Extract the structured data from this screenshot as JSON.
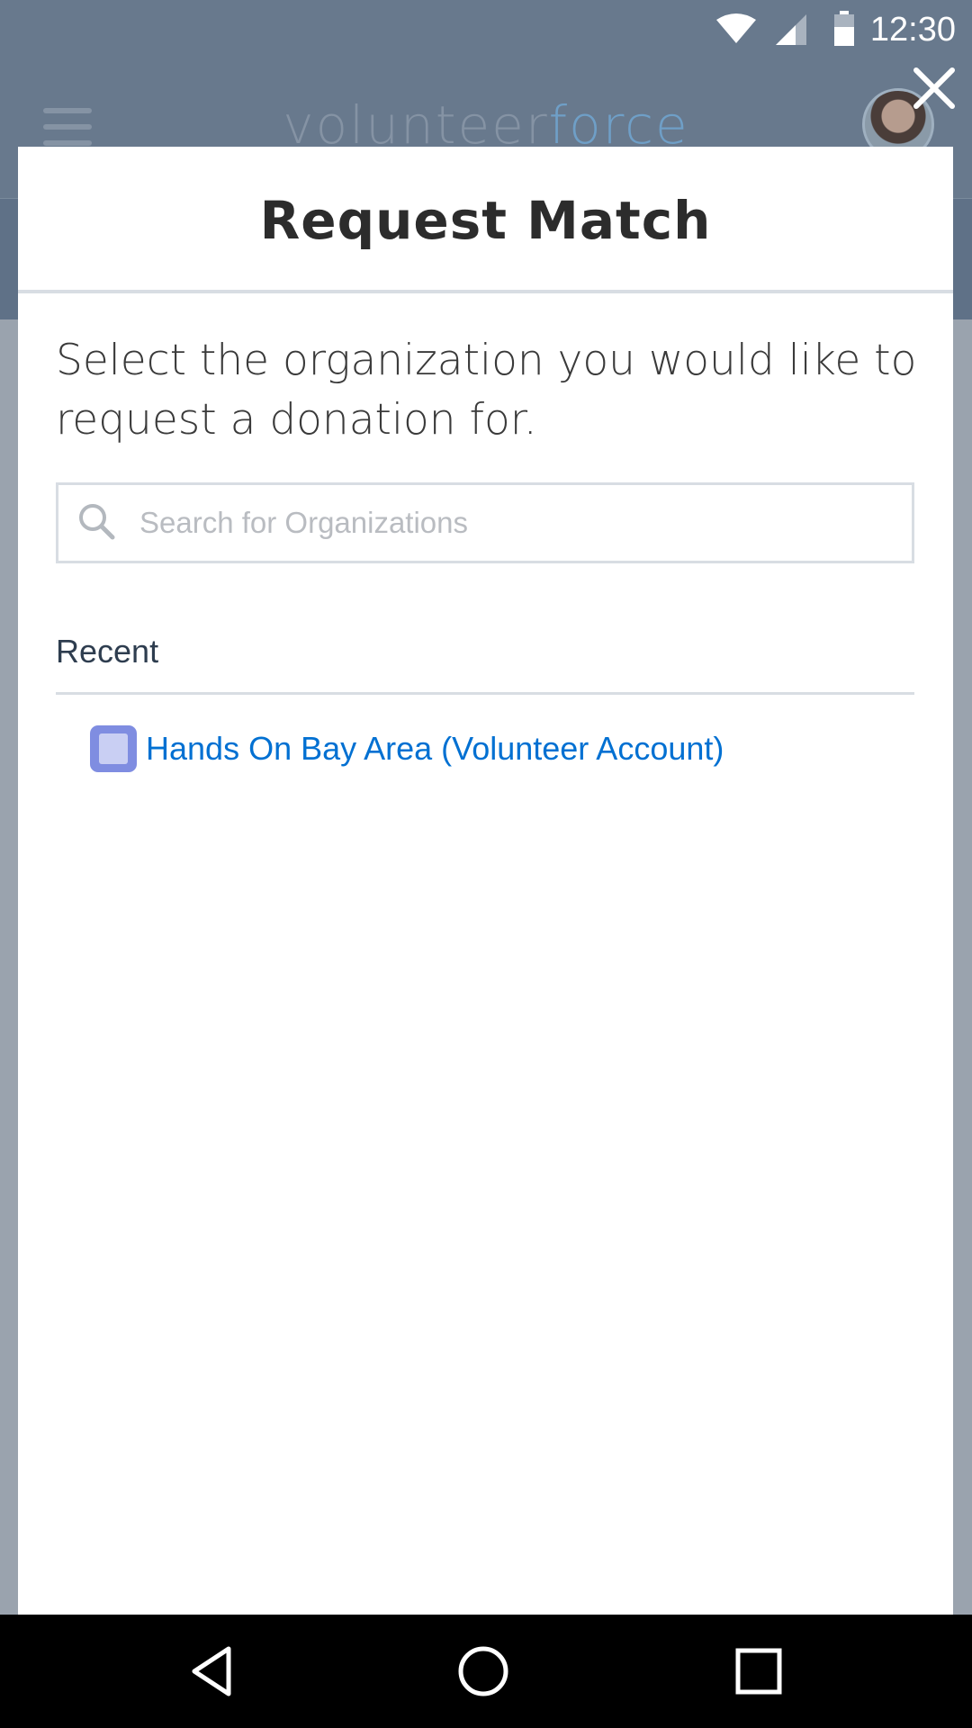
{
  "status_bar": {
    "time": "12:30",
    "icons": [
      "wifi-icon",
      "signal-icon",
      "battery-icon"
    ]
  },
  "background_app": {
    "brand_primary": "volunteer",
    "brand_accent": "force",
    "brand_color": "#8593a4",
    "brand_accent_color": "#6f9fc7",
    "icons": [
      "hamburger-menu-icon",
      "avatar"
    ]
  },
  "modal": {
    "close_icon": "close-icon",
    "title": "Request Match",
    "instructions": "Select the organization you would like to request a donation for.",
    "search": {
      "placeholder": "Search for Organizations",
      "value": "",
      "icon": "search-icon"
    },
    "recent_label": "Recent",
    "recent_items": [
      {
        "label": "Hands On Bay Area (Volunteer Account)",
        "icon": "account-icon",
        "color": "#0070d2"
      }
    ]
  },
  "nav_bar": {
    "buttons": [
      "back-icon",
      "home-icon",
      "recents-icon"
    ]
  },
  "colors": {
    "overlay": "#68798d",
    "link": "#0070d2",
    "divider": "#d8dde3",
    "account_icon": "#7f8de1"
  }
}
